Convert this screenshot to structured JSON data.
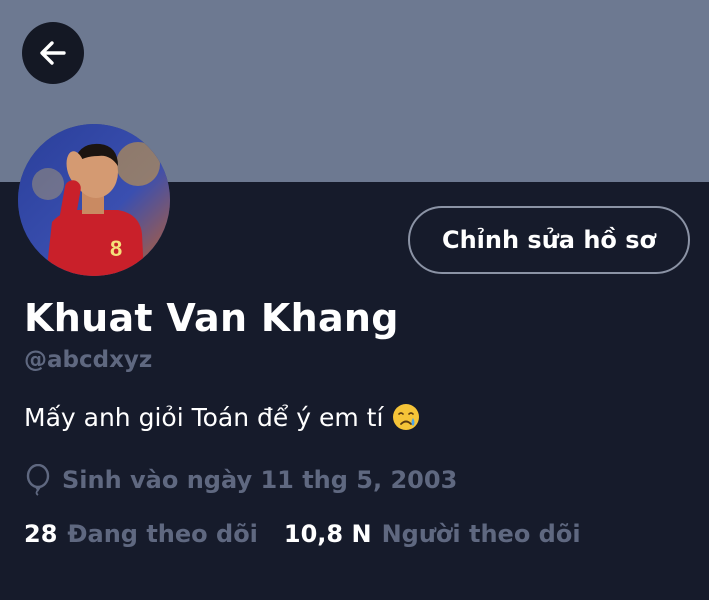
{
  "profile": {
    "name": "Khuat Van Khang",
    "handle": "@abcdxyz",
    "bio": "Mấy anh giỏi Toán để ý em tí",
    "bio_emoji": "crying-face",
    "birth": "Sinh vào ngày 11 thg 5, 2003",
    "avatar_jersey_number": "8"
  },
  "actions": {
    "edit_profile": "Chỉnh sửa hồ sơ",
    "back_icon": "arrow-left"
  },
  "stats": {
    "following_count": "28",
    "following_label": "Đang theo dõi",
    "followers_count": "10,8 N",
    "followers_label": "Người theo dõi"
  },
  "colors": {
    "banner": "#6d7991",
    "background": "#161b2b",
    "muted_text": "#5f6880",
    "button_border": "#8b93a5"
  }
}
